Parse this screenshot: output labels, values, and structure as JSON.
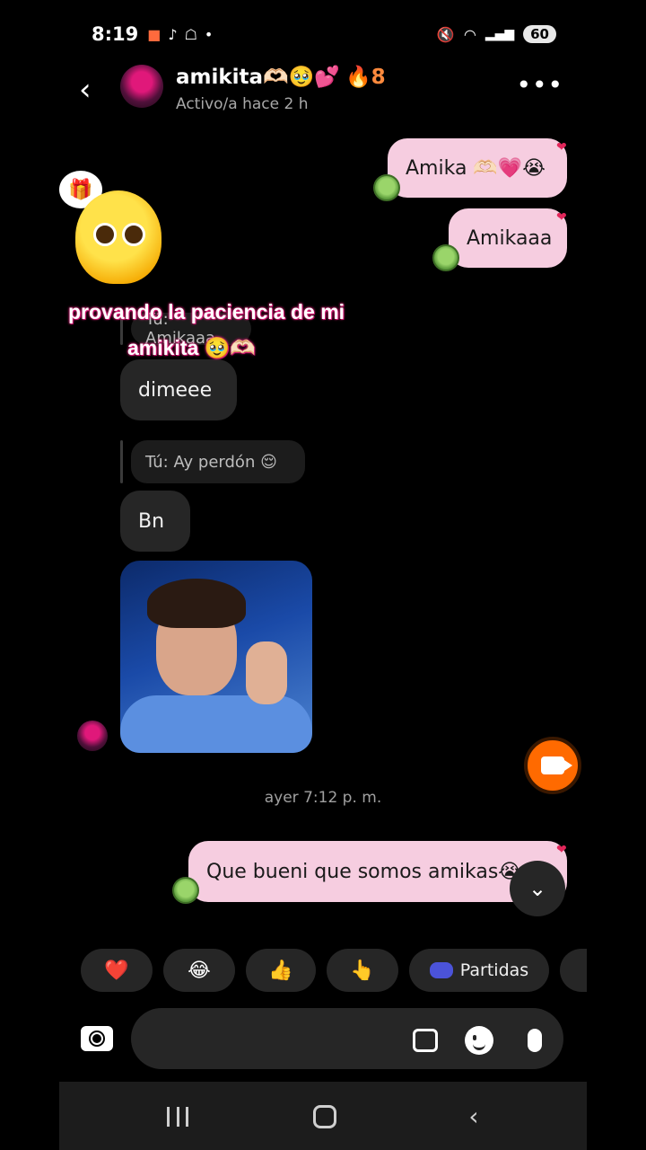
{
  "status_bar": {
    "time": "8:19",
    "battery": "60",
    "left_icons": [
      "video-recording-icon",
      "tiktok-icon",
      "snapchat-icon",
      "dot-icon"
    ],
    "right_icons": [
      "mute-icon",
      "wifi-icon",
      "signal-icon"
    ]
  },
  "header": {
    "name": "amikita🫶🏻🥹💕",
    "streak": "🔥8",
    "status": "Activo/a hace 2 h"
  },
  "messages": {
    "out_1": "Amika 🫶🏻💗😭",
    "out_2": "Amikaaa",
    "reply_1": "Tú: Amikaaa",
    "in_1": "dimeee",
    "reply_2": "Tú: Ay perdón 😌",
    "in_2": "Bn",
    "timestamp": "ayer 7:12 p. m.",
    "out_3": "Que bueni que somos amikas😭"
  },
  "overlay": {
    "caption_line1": "provando la paciencia de mi",
    "caption_line2": "amikita 🥹🫶🏻",
    "gift": "🎁"
  },
  "quick_replies": {
    "heart": "❤️",
    "laugh": "😂",
    "thumbs": "👍",
    "point": "👆",
    "games_label": "Partidas"
  },
  "colors": {
    "outgoing_bubble": "#f6cde0",
    "incoming_bubble": "#262626",
    "video_call": "#ff6a00"
  }
}
